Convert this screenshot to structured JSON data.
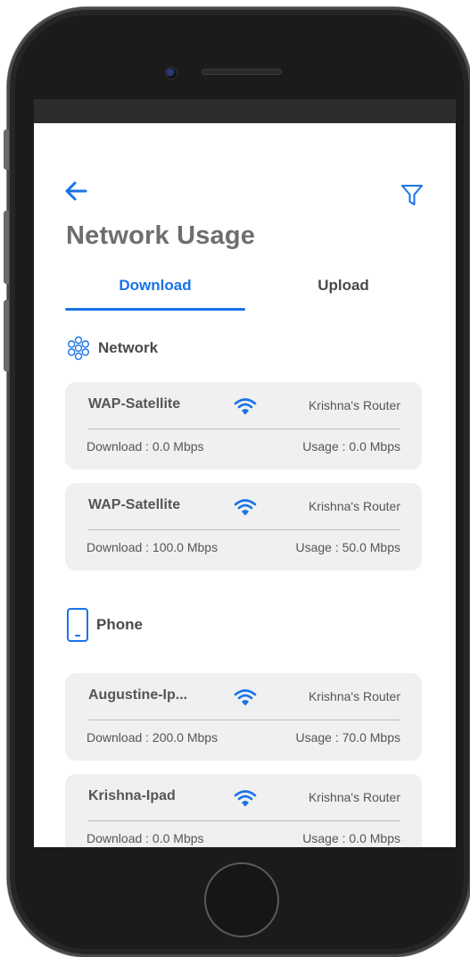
{
  "page": {
    "title": "Network Usage"
  },
  "tabs": {
    "download": "Download",
    "upload": "Upload"
  },
  "sections": {
    "network": {
      "label": "Network",
      "icon": "network-cluster-icon"
    },
    "phone": {
      "label": "Phone",
      "icon": "phone-icon"
    }
  },
  "cards": [
    {
      "name": "WAP-Satellite",
      "router": "Krishna's Router",
      "download": "Download : 0.0 Mbps",
      "usage": "Usage : 0.0 Mbps"
    },
    {
      "name": "WAP-Satellite",
      "router": "Krishna's Router",
      "download": "Download : 100.0 Mbps",
      "usage": "Usage : 50.0 Mbps"
    },
    {
      "name": "Augustine-Ip...",
      "router": "Krishna's Router",
      "download": "Download : 200.0 Mbps",
      "usage": "Usage : 70.0 Mbps"
    },
    {
      "name": "Krishna-Ipad",
      "router": "Krishna's Router",
      "download": "Download : 0.0 Mbps",
      "usage": "Usage : 0.0 Mbps"
    }
  ],
  "icons": {
    "back": "back-arrow-icon",
    "filter": "filter-icon",
    "wifi": "wifi-icon"
  },
  "colors": {
    "accent": "#1a73e8",
    "card_bg": "#f0f0f0",
    "title": "#6e6e6e"
  }
}
